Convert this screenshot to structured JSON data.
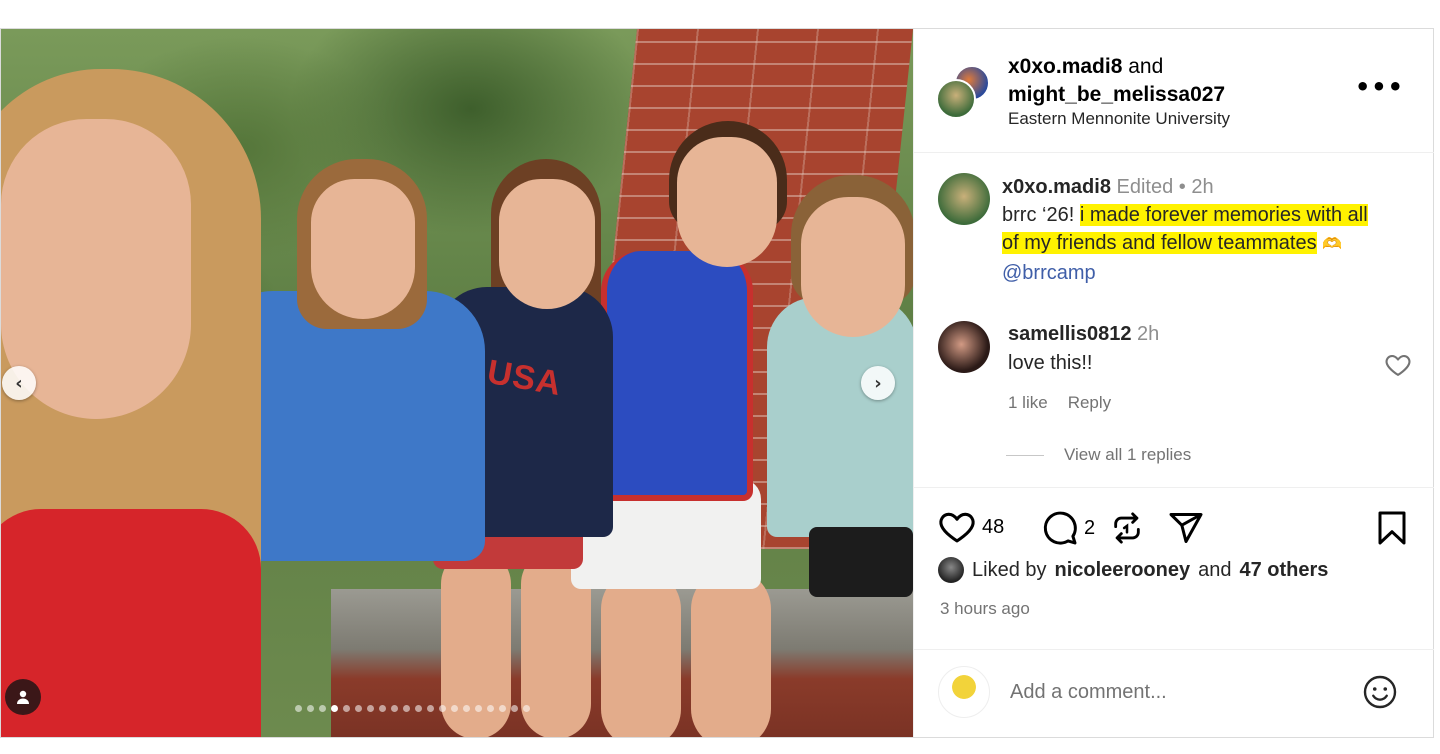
{
  "header": {
    "user1": "x0xo.madi8",
    "and_text": "and",
    "user2": "might_be_melissa027",
    "location": "Eastern Mennonite University",
    "more_label": "•••"
  },
  "caption": {
    "username": "x0xo.madi8",
    "edited": "Edited",
    "separator": "•",
    "time": "2h",
    "text_plain": "brrc ‘26! ",
    "text_highlight_1": "i made forever memories with all",
    "text_highlight_2": "of my friends and fellow teammates",
    "emoji": "🫶",
    "mention": "@brrcamp"
  },
  "comment": {
    "username": "samellis0812",
    "time": "2h",
    "text": "love this!!",
    "likes": "1 like",
    "reply": "Reply",
    "view_replies": "View all 1 replies"
  },
  "actions": {
    "like_count": "48",
    "comment_count": "2"
  },
  "liked_by": {
    "prefix": "Liked by",
    "user": "nicoleerooney",
    "and": "and",
    "others": "47 others"
  },
  "timestamp": "3 hours ago",
  "add_comment": {
    "placeholder": "Add a comment..."
  },
  "carousel": {
    "prev": "‹",
    "next": "›",
    "dot_count": 20,
    "active_index": 3
  },
  "photo": {
    "shirt_text": "USA"
  },
  "colors": {
    "highlight": "#fff200",
    "mention": "#3f5ea8",
    "muted": "#737373"
  }
}
